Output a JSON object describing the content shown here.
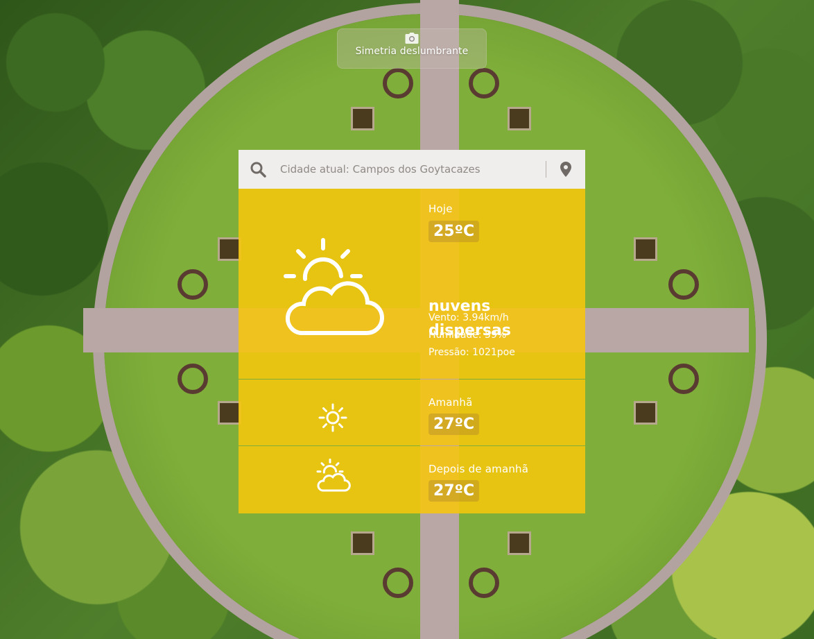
{
  "caption": {
    "icon": "camera-icon",
    "text": "Simetria deslumbrante"
  },
  "search": {
    "placeholder": "Cidade atual: Campos dos Goytacazes",
    "value": "",
    "search_icon": "search-icon",
    "location_icon": "location-pin-icon"
  },
  "colors": {
    "panel": "#f6c60c",
    "search_bg": "#f0eeec",
    "text": "#ffffff"
  },
  "today": {
    "label": "Hoje",
    "temp": "25ºC",
    "icon": "partly-cloudy-icon",
    "description_line1": "nuvens",
    "description_line2": "dispersas",
    "wind": "Vento: 3.94km/h",
    "humidity": "Humidade: 59%",
    "pressure": "Pressão: 1021poe"
  },
  "tomorrow": {
    "label": "Amanhã",
    "temp": "27ºC",
    "icon": "sun-icon"
  },
  "after_tomorrow": {
    "label": "Depois de amanhã",
    "temp": "27ºC",
    "icon": "partly-cloudy-icon"
  }
}
